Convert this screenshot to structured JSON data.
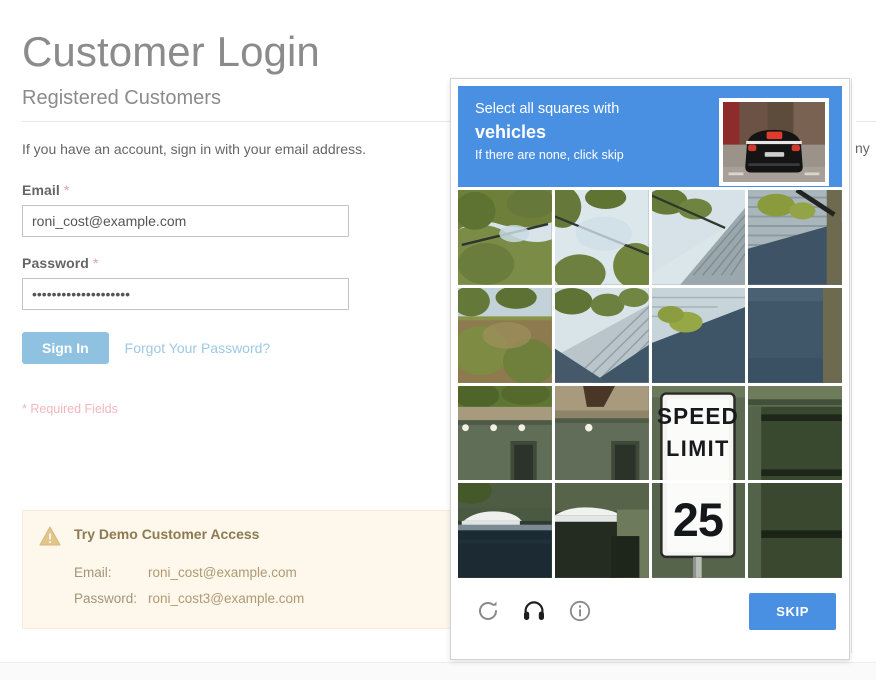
{
  "page": {
    "title": "Customer Login",
    "section_title": "Registered Customers",
    "lede": "If you have an account, sign in with your email address.",
    "required_note": "* Required Fields",
    "required_marker": "*"
  },
  "form": {
    "email": {
      "label": "Email",
      "value": "roni_cost@example.com",
      "placeholder": "roni_cost@example.com"
    },
    "password": {
      "label": "Password",
      "value": "••••••••••••••••••••",
      "placeholder": ""
    },
    "sign_in_label": "Sign In",
    "forgot_label": "Forgot Your Password?"
  },
  "demo": {
    "icon": "warning-triangle-icon",
    "title": "Try Demo Customer Access",
    "rows": [
      {
        "key": "Email:",
        "value": "roni_cost@example.com"
      },
      {
        "key": "Password:",
        "value": "roni_cost3@example.com"
      }
    ]
  },
  "right_column": {
    "clipped_text": "ny"
  },
  "captcha": {
    "instruction_line1": "Select all squares with",
    "instruction_line2": "vehicles",
    "instruction_line3": "If there are none, click skip",
    "example_thumb_alt": "rear view of a black car on a street",
    "skip_label": "SKIP",
    "icons": [
      {
        "name": "reload-icon"
      },
      {
        "name": "headphones-icon"
      },
      {
        "name": "info-icon"
      }
    ],
    "grid": {
      "rows": 4,
      "cols": 4,
      "tiles": [
        {
          "id": "r1c1",
          "scene": "tree-sky"
        },
        {
          "id": "r1c2",
          "scene": "tree-sky"
        },
        {
          "id": "r1c3",
          "scene": "tree-roof"
        },
        {
          "id": "r1c4",
          "scene": "roof-wall"
        },
        {
          "id": "r2c1",
          "scene": "tree-foliage"
        },
        {
          "id": "r2c2",
          "scene": "tree-roof"
        },
        {
          "id": "r2c3",
          "scene": "roof-shadow"
        },
        {
          "id": "r2c4",
          "scene": "wall"
        },
        {
          "id": "r3c1",
          "scene": "house-foliage"
        },
        {
          "id": "r3c2",
          "scene": "house-wall"
        },
        {
          "id": "r3c3",
          "scene": "speed-limit-sign-top"
        },
        {
          "id": "r3c4",
          "scene": "dark-wall"
        },
        {
          "id": "r4c1",
          "scene": "house-car"
        },
        {
          "id": "r4c2",
          "scene": "house-car"
        },
        {
          "id": "r4c3",
          "scene": "speed-limit-sign-bottom"
        },
        {
          "id": "r4c4",
          "scene": "dark-wall"
        }
      ]
    },
    "sign_text": {
      "line1": "SPEED",
      "line2": "LIMIT",
      "line3": "25"
    }
  },
  "colors": {
    "accent_blue": "#4a90e2",
    "button_blue": "#8fc2e0",
    "link_blue": "#9fc9e4",
    "required_pink": "#e8a0a8",
    "demo_bg": "#fdf7ec",
    "demo_text": "#a08f6e",
    "heading_gray": "#8b8b8b"
  }
}
